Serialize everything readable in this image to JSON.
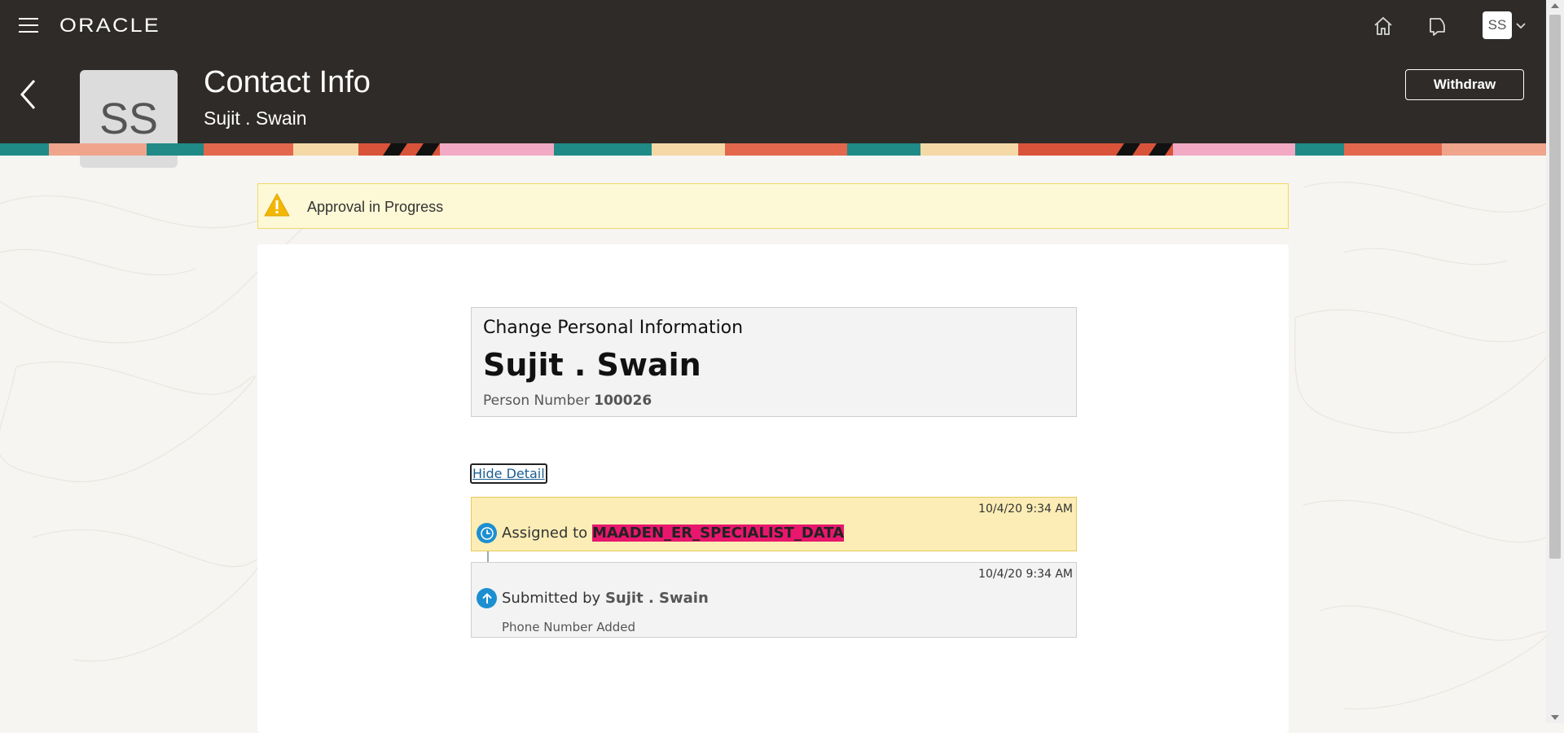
{
  "topbar": {
    "logo": "ORACLE",
    "user_initials": "SS",
    "icons": [
      "hamburger-icon",
      "home-icon",
      "notifications-icon",
      "chevron-down-icon"
    ]
  },
  "header": {
    "title": "Contact Info",
    "subtitle": "Sujit . Swain",
    "avatar_initials": "SS",
    "withdraw_label": "Withdraw"
  },
  "banner": {
    "text": "Approval in Progress",
    "icon": "warning-icon"
  },
  "summary": {
    "type": "Change Personal Information",
    "name": "Sujit . Swain",
    "person_number_label": "Person Number",
    "person_number": "100026"
  },
  "detail_toggle": "Hide Detail",
  "history": {
    "assigned": {
      "time": "10/4/20 9:34 AM",
      "prefix": "Assigned to",
      "assignee": "MAADEN_ER_SPECIALIST_DATA"
    },
    "submitted": {
      "time": "10/4/20 9:34 AM",
      "prefix": "Submitted by",
      "submitter": "Sujit . Swain",
      "detail": "Phone Number Added"
    }
  },
  "colors": {
    "header_bg": "#2e2b28",
    "banner_bg": "#fdf8d6",
    "assigned_bg": "#fbedb5",
    "highlight": "#e8176d",
    "icon_blue": "#1c8fd1"
  }
}
